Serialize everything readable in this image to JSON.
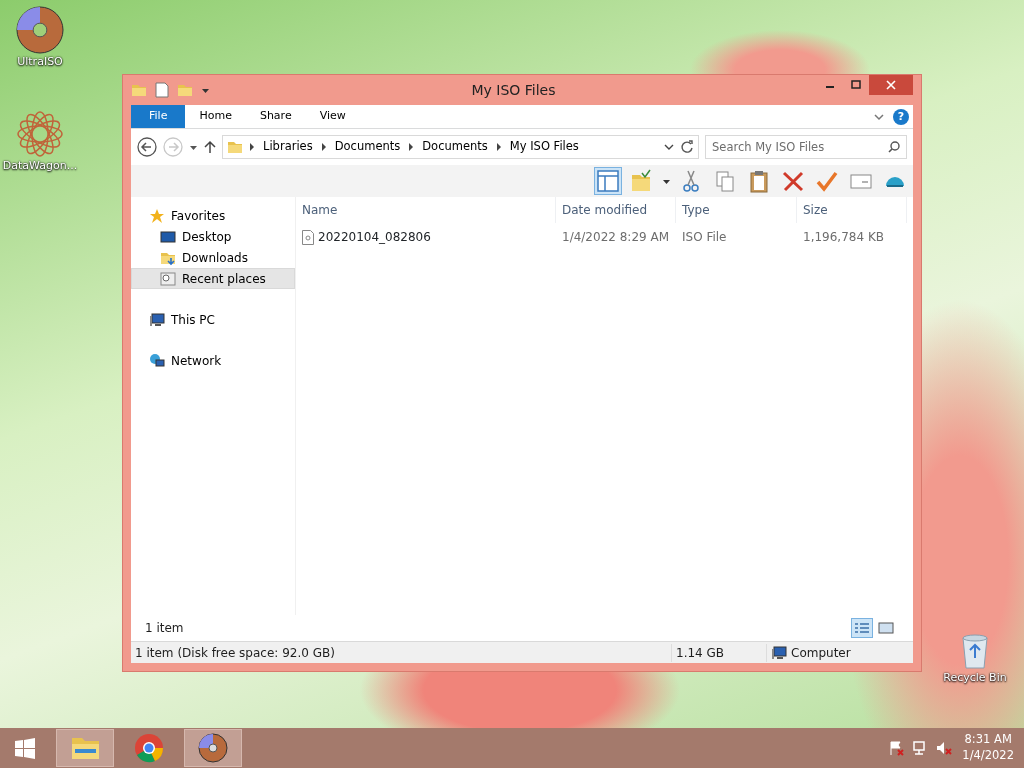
{
  "desktop_icons": [
    {
      "label": "UltraISO",
      "kind": "disc"
    },
    {
      "label": "DataWagon...",
      "kind": "star"
    },
    {
      "label": "Recycle Bin",
      "kind": "bin"
    }
  ],
  "window": {
    "title": "My ISO Files",
    "ribbon": {
      "tabs": [
        {
          "label": "File",
          "kind": "menu"
        },
        {
          "label": "Home",
          "kind": "tab"
        },
        {
          "label": "Share",
          "kind": "tab"
        },
        {
          "label": "View",
          "kind": "tab"
        }
      ],
      "help": "?"
    },
    "nav": {
      "back_disabled": false,
      "forward_disabled": true
    },
    "breadcrumbs": [
      "Libraries",
      "Documents",
      "Documents",
      "My ISO Files"
    ],
    "search": {
      "placeholder": "Search My ISO Files"
    },
    "sidebar": [
      {
        "label": "Favorites",
        "kind": "star",
        "selected": false,
        "children": [
          {
            "label": "Desktop",
            "kind": "desktop",
            "selected": false
          },
          {
            "label": "Downloads",
            "kind": "downloads",
            "selected": false
          },
          {
            "label": "Recent places",
            "kind": "recent",
            "selected": true
          }
        ]
      },
      {
        "label": "This PC",
        "kind": "pc",
        "selected": false
      },
      {
        "label": "Network",
        "kind": "network",
        "selected": false
      }
    ],
    "columns": [
      "Name",
      "Date modified",
      "Type",
      "Size"
    ],
    "rows": [
      {
        "name": "20220104_082806",
        "date": "1/4/2022 8:29 AM",
        "type": "ISO File",
        "size": "1,196,784 KB"
      }
    ],
    "item_count": "1 item",
    "views": [
      {
        "kind": "details",
        "selected": true
      },
      {
        "kind": "large",
        "selected": false
      }
    ],
    "status_bar": {
      "summary": "1 item (Disk free space: 92.0 GB)",
      "size": "1.14 GB",
      "location": "Computer"
    }
  },
  "taskbar": {
    "buttons": [
      {
        "kind": "explorer",
        "selected": true
      },
      {
        "kind": "chrome",
        "selected": false
      },
      {
        "kind": "disc",
        "selected": true
      }
    ],
    "time": "8:31 AM",
    "date": "1/4/2022"
  }
}
